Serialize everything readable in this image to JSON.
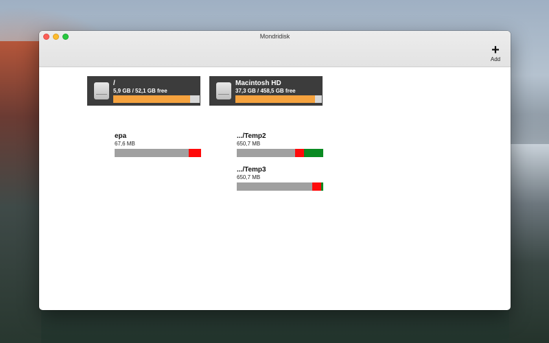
{
  "window": {
    "title": "Mondridisk"
  },
  "toolbar": {
    "add_label": "Add",
    "add_icon": "plus-icon"
  },
  "disks": [
    {
      "name": "/",
      "usage": "5,9 GB / 52,1 GB free",
      "used_fraction": 0.887,
      "icon": "hard-drive-icon"
    },
    {
      "name": "Macintosh HD",
      "usage": "37,3 GB / 458,5 GB free",
      "used_fraction": 0.919,
      "icon": "hard-drive-icon"
    }
  ],
  "folders": [
    {
      "name": "epa",
      "size": "67,6 MB",
      "segments": [
        {
          "color": "#a0a0a0",
          "fraction": 0.855
        },
        {
          "color": "#ff0a0a",
          "fraction": 0.145
        }
      ]
    },
    {
      "name": ".../Temp2",
      "size": "650,7 MB",
      "segments": [
        {
          "color": "#a0a0a0",
          "fraction": 0.675
        },
        {
          "color": "#ff0a0a",
          "fraction": 0.105
        },
        {
          "color": "#0a8a22",
          "fraction": 0.22
        }
      ]
    },
    {
      "name": ".../Temp3",
      "size": "650,7 MB",
      "segments": [
        {
          "color": "#a0a0a0",
          "fraction": 0.87
        },
        {
          "color": "#ff0a0a",
          "fraction": 0.105
        },
        {
          "color": "#0a8a22",
          "fraction": 0.025
        }
      ]
    }
  ],
  "colors": {
    "disk_fill": "#f5a23e",
    "disk_bg": "#3c3c3c",
    "used": "#a0a0a0",
    "red": "#ff0a0a",
    "green": "#0a8a22"
  }
}
